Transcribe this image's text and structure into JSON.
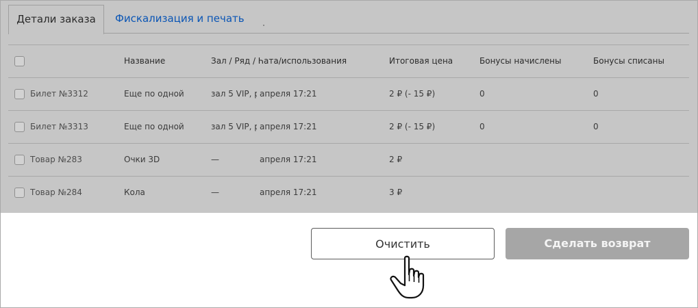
{
  "tabs": [
    {
      "label": "Детали заказа",
      "active": true
    },
    {
      "label": "Фискализация и печать",
      "active": false
    }
  ],
  "table": {
    "headers": {
      "name": "Название",
      "hall_date": "Зал / Ряд / Һата/использования",
      "price": "Итоговая цена",
      "bonus_added": "Бонусы начислены",
      "bonus_spent": "Бонусы списаны"
    },
    "rows": [
      {
        "id": "Билет №3312",
        "name": "Еще по одной",
        "hall": "зал 5 VIP, ря",
        "date": "апреля 17:21",
        "price": "2 ₽ (- 15 ₽)",
        "bonus_added": "0",
        "bonus_spent": "0"
      },
      {
        "id": "Билет №3313",
        "name": "Еще по одной",
        "hall": "зал 5 VIP, ря",
        "date": "апреля 17:21",
        "price": "2 ₽ (- 15 ₽)",
        "bonus_added": "0",
        "bonus_spent": "0"
      },
      {
        "id": "Товар №283",
        "name": "Очки 3D",
        "hall": "—",
        "date": "апреля 17:21",
        "price": "2 ₽",
        "bonus_added": "",
        "bonus_spent": ""
      },
      {
        "id": "Товар №284",
        "name": "Кола",
        "hall": "—",
        "date": "апреля 17:21",
        "price": "3 ₽",
        "bonus_added": "",
        "bonus_spent": ""
      }
    ]
  },
  "buttons": {
    "clear": "Очистить",
    "refund": "Сделать возврат"
  },
  "colors": {
    "link": "#0a55b5",
    "overlay": "#c6c6c6",
    "refund_button": "#a6a6a6"
  },
  "icons": {
    "cursor": "hand-pointer-icon",
    "checkbox": "checkbox-icon"
  }
}
